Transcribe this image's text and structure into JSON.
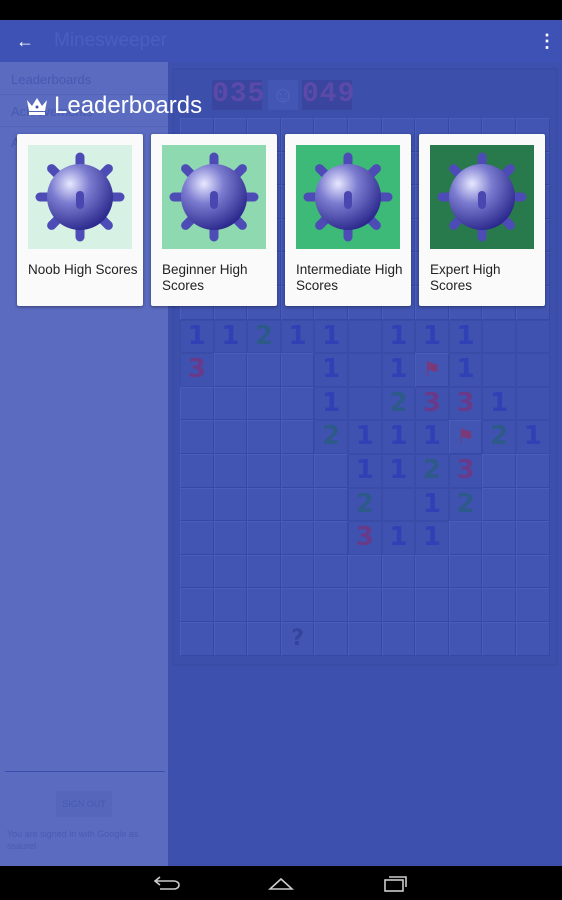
{
  "app": {
    "title": "Minesweeper",
    "back_icon": "arrow-left-icon",
    "menu_icon": "more-vert-icon"
  },
  "game": {
    "mines_left": "035",
    "time": "049",
    "smiley_icon": "smiley-icon",
    "rows": [
      "hhhhhhhhhhh",
      "hhhhhhhhhhh",
      "hhhhhhhhhhh",
      "hhhhhhhhhhh",
      "hhhhhhhhhhh",
      "hhhhhhhhhhh",
      "11211.111..",
      "3hhh1.1F1..",
      "hhhh1.2331.",
      "hhhh2111F21",
      "hhhhh1123hh",
      "hhhhh2.12hh",
      "hhhhh311hhh",
      "hhhhhhhhhhh",
      "hhhhhhhhhhh",
      "hhh?hhhhhhh"
    ]
  },
  "drawer": {
    "items": [
      "Leaderboards",
      "Achievements",
      "A"
    ],
    "sign_out": "SIGN OUT",
    "signed_in_text": "You are signed in with Google as ssaurel"
  },
  "leaderboards": {
    "title": "Leaderboards",
    "icon": "crown-icon",
    "cards": [
      {
        "label": "Noob High Scores",
        "color": "#d7f1e5"
      },
      {
        "label": "Beginner High Scores",
        "color": "#8fd9b1"
      },
      {
        "label": "Intermediate High Scores",
        "color": "#3dba77"
      },
      {
        "label": "Expert High Scores",
        "color": "#287a4c"
      }
    ]
  },
  "nav": {
    "back": "back-icon",
    "home": "home-icon",
    "recents": "recents-icon"
  }
}
